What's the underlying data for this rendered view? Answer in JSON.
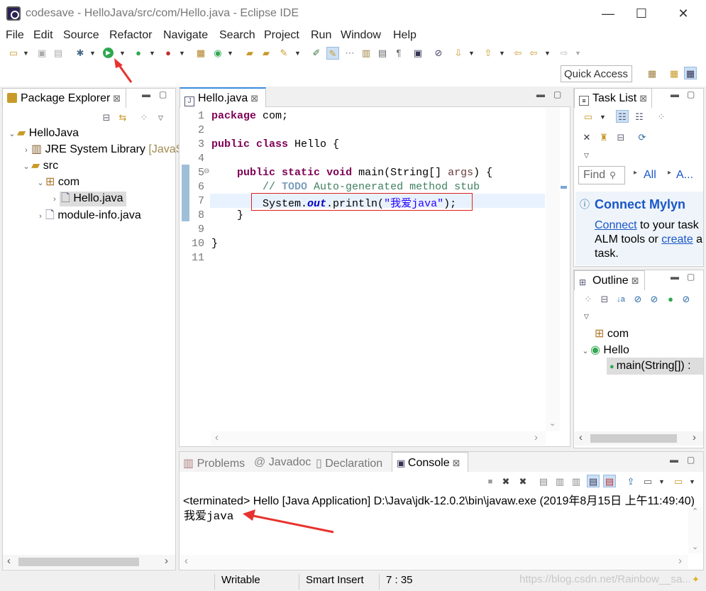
{
  "window": {
    "title": "codesave - HelloJava/src/com/Hello.java - Eclipse IDE",
    "minimize": "—",
    "maximize": "☐",
    "close": "✕"
  },
  "menu": [
    "File",
    "Edit",
    "Source",
    "Refactor",
    "Navigate",
    "Search",
    "Project",
    "Run",
    "Window",
    "Help"
  ],
  "toolbar": {
    "quick_access": "Quick Access"
  },
  "package_explorer": {
    "tab_label": "Package Explorer",
    "tree": {
      "project": "HelloJava",
      "jre": "JRE System Library",
      "jre_suffix": "[JavaS",
      "src": "src",
      "package": "com",
      "file_selected": "Hello.java",
      "module_file": "module-info.java"
    }
  },
  "editor": {
    "tab_label": "Hello.java",
    "line_numbers": [
      "1",
      "2",
      "3",
      "4",
      "5",
      "6",
      "7",
      "8",
      "9",
      "10",
      "11"
    ],
    "code": {
      "l1_kw": "package",
      "l1_rest": " com;",
      "l3_kw1": "public",
      "l3_kw2": "class",
      "l3_rest": " Hello {",
      "l5_kw1": "public",
      "l5_kw2": "static",
      "l5_kw3": "void",
      "l5_rest": " main(String[] ",
      "l5_param": "args",
      "l5_end": ") {",
      "l6_comment1": "// ",
      "l6_todo": "TODO",
      "l6_comment2": " Auto-generated method stub",
      "l7_a": "System.",
      "l7_field": "out",
      "l7_b": ".println(",
      "l7_str": "\"我爱java\"",
      "l7_c": ");",
      "l8": "}",
      "l10": "}"
    }
  },
  "task_list": {
    "tab_label": "Task List",
    "find_placeholder": "Find",
    "all_label": "All",
    "activate_label": "A...",
    "mylyn": {
      "title": "Connect Mylyn",
      "connect_link": "Connect",
      "text1": " to your task",
      "text2": "ALM tools or ",
      "create_link": "create",
      "text3": " a",
      "text4": "task."
    }
  },
  "outline": {
    "tab_label": "Outline",
    "items": {
      "package": "com",
      "class": "Hello",
      "method": "main(String[]) :"
    }
  },
  "bottom_tabs": {
    "problems": "Problems",
    "javadoc": "Javadoc",
    "declaration": "Declaration",
    "console": "Console"
  },
  "console": {
    "status_line": "<terminated> Hello [Java Application] D:\\Java\\jdk-12.0.2\\bin\\javaw.exe (2019年8月15日 上午11:49:40)",
    "output": "我爱java"
  },
  "statusbar": {
    "writable": "Writable",
    "insert_mode": "Smart Insert",
    "position": "7 : 35",
    "watermark": "https://blog.csdn.net/Rainbow__sa..."
  },
  "colors": {
    "annotation_red": "#e8322e",
    "highlight_box": "#e02020",
    "link_blue": "#1a56c8"
  }
}
